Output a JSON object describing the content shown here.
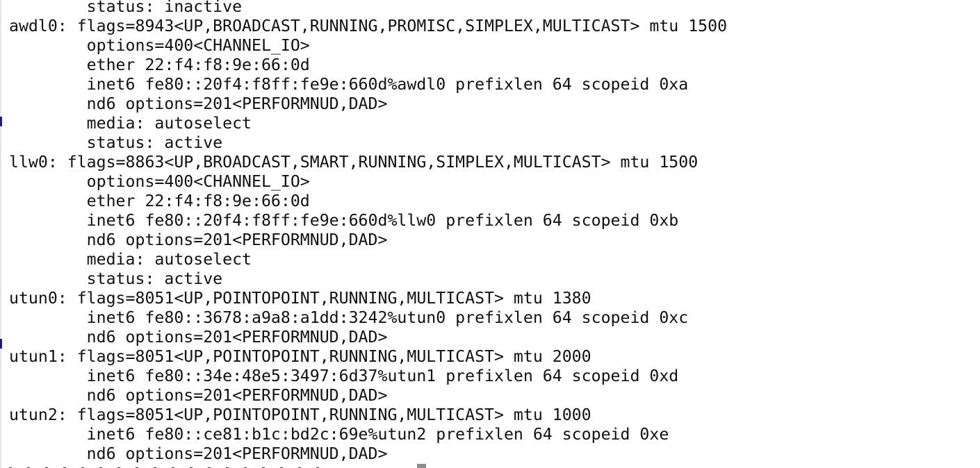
{
  "terminal": {
    "lines": [
      "        status: inactive",
      "awdl0: flags=8943<UP,BROADCAST,RUNNING,PROMISC,SIMPLEX,MULTICAST> mtu 1500",
      "        options=400<CHANNEL_IO>",
      "        ether 22:f4:f8:9e:66:0d",
      "        inet6 fe80::20f4:f8ff:fe9e:660d%awdl0 prefixlen 64 scopeid 0xa",
      "        nd6 options=201<PERFORMNUD,DAD>",
      "        media: autoselect",
      "        status: active",
      "llw0: flags=8863<UP,BROADCAST,SMART,RUNNING,SIMPLEX,MULTICAST> mtu 1500",
      "        options=400<CHANNEL_IO>",
      "        ether 22:f4:f8:9e:66:0d",
      "        inet6 fe80::20f4:f8ff:fe9e:660d%llw0 prefixlen 64 scopeid 0xb",
      "        nd6 options=201<PERFORMNUD,DAD>",
      "        media: autoselect",
      "        status: active",
      "utun0: flags=8051<UP,POINTOPOINT,RUNNING,MULTICAST> mtu 1380",
      "        inet6 fe80::3678:a9a8:a1dd:3242%utun0 prefixlen 64 scopeid 0xc",
      "        nd6 options=201<PERFORMNUD,DAD>",
      "utun1: flags=8051<UP,POINTOPOINT,RUNNING,MULTICAST> mtu 2000",
      "        inet6 fe80::34e:48e5:3497:6d37%utun1 prefixlen 64 scopeid 0xd",
      "        nd6 options=201<PERFORMNUD,DAD>",
      "utun2: flags=8051<UP,POINTOPOINT,RUNNING,MULTICAST> mtu 1000",
      "        inet6 fe80::ce81:b1c:bd2c:69e%utun2 prefixlen 64 scopeid 0xe",
      "        nd6 options=201<PERFORMNUD,DAD>"
    ]
  },
  "colors": {
    "background": "#ffffff",
    "text": "#111111",
    "cursor": "#8c8c8c"
  }
}
